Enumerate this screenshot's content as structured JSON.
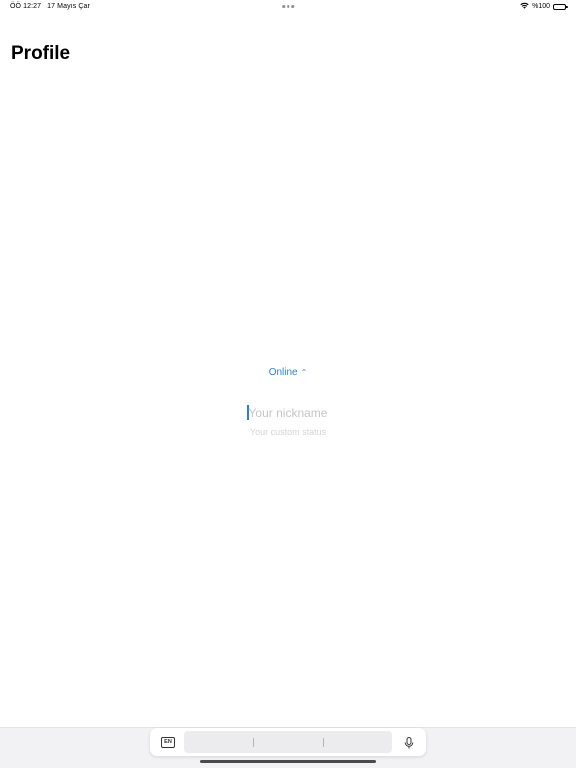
{
  "status_bar": {
    "time": "ÖÖ 12:27",
    "date": "17 Mayıs Çar",
    "battery_text": "%100"
  },
  "header": {
    "title": "Profile"
  },
  "profile": {
    "status_value": "Online",
    "nickname": {
      "value": "",
      "placeholder": "Your nickname"
    },
    "custom_status": {
      "value": "",
      "placeholder": "Your custom status"
    }
  },
  "keyboard_bar": {
    "language": "EN"
  },
  "colors": {
    "accent": "#2f7fd6"
  },
  "icons": [
    "wifi-icon",
    "battery-icon",
    "up-down-chevron-icon",
    "microphone-icon",
    "keyboard-language-icon"
  ]
}
